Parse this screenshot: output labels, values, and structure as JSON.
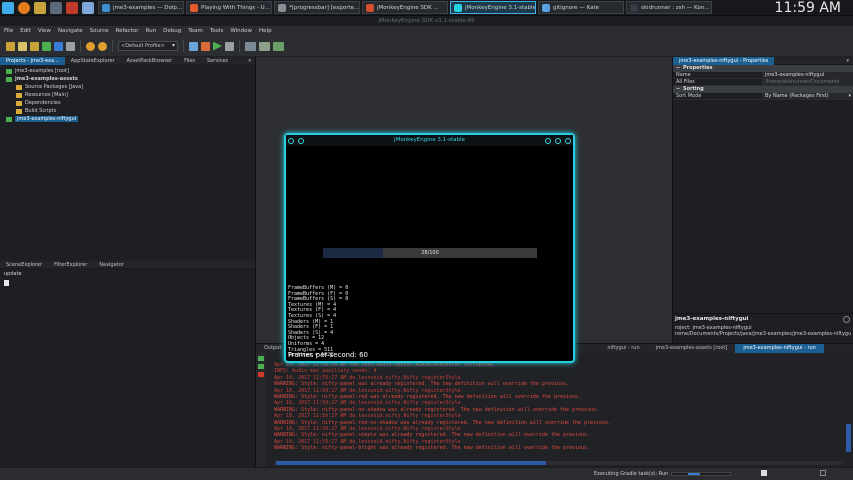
{
  "taskbar": {
    "tasks": [
      {
        "label": "jme3-examples — Dolp...",
        "color": "#3d8fd1",
        "active": false
      },
      {
        "label": "Playing With Things - U...",
        "color": "#e55b2b",
        "active": false
      },
      {
        "label": "*[progressbar] [exporte...",
        "color": "#8a8f96",
        "active": false
      },
      {
        "label": "jMonkeyEngine SDK ...",
        "color": "#d44f2b",
        "active": false
      },
      {
        "label": "jMonkeyEngine 3.1-stable",
        "color": "#27d0e0",
        "active": true
      },
      {
        "label": "gitignore — Kate",
        "color": "#5aa0e0",
        "active": false
      },
      {
        "label": "skidrunner : zsh — Kon...",
        "color": "#333b44",
        "active": false
      }
    ],
    "clock": "11:59 AM"
  },
  "titlebar": {
    "title": "jMonkeyEngine SDK v3.1-stable-86"
  },
  "menu": [
    "File",
    "Edit",
    "View",
    "Navigate",
    "Source",
    "Refactor",
    "Run",
    "Debug",
    "Team",
    "Tools",
    "Window",
    "Help"
  ],
  "toolbar": {
    "profile": "<Default Profile>"
  },
  "projects": {
    "tabs": [
      "Projects - jme3-exa...",
      "AppStateExplorer",
      "AssetPackBrowser",
      "Files",
      "Services"
    ],
    "tree": [
      {
        "label": "jme3-examples [root]",
        "bold": false
      },
      {
        "label": "jme3-examples-assets",
        "bold": true
      },
      {
        "label": "Source Packages [Java]",
        "bold": false
      },
      {
        "label": "Resources [Main]",
        "bold": false
      },
      {
        "label": "Dependencies",
        "bold": false
      },
      {
        "label": "Build Scripts",
        "bold": false
      },
      {
        "label": "jme3-examples-niftygui",
        "bold": false
      }
    ]
  },
  "bottomleft": {
    "tabs": [
      "SceneExplorer",
      "FilterExplorer",
      "Navigator"
    ],
    "item": "update"
  },
  "properties": {
    "tab": "jme3-examples-niftygui - Properties",
    "section1": "Properties",
    "rows": [
      {
        "k": "Name",
        "v": "jme3-examples-niftygui"
      },
      {
        "k": "All Files",
        "v": "/home/skidrunner/Documents"
      }
    ],
    "section2": "Sorting",
    "sort": {
      "k": "Sort Mode",
      "v": "By Name (Packages First)"
    },
    "info_title": "jme3-examples-niftygui",
    "info_line1": "roject: jme3-examples-niftygui",
    "info_line2": "rome/Documents/Projects/java/jme3-examples/jme3-examples-niftygui"
  },
  "output": {
    "panel_label": "Output",
    "tabs": [
      "niftygui - run",
      "jme3-examples-assets [root]",
      "jme3-examples-niftygui - run"
    ],
    "lines": [
      "Apr 10, 2017 11:59:26 AM com.jme3.audio.openal.ALAudioRenderer initOpenAL",
      "INFO: Audio max auxiliary sends: 4",
      "Apr 10, 2017 11:59:27 AM de.lessvoid.nifty.Nifty registerStyle",
      "WARNING: Style: nifty-panel was already registered. The new definition will override the previous.",
      "Apr 10, 2017 11:59:27 AM de.lessvoid.nifty.Nifty registerStyle",
      "WARNING: Style: nifty-panel-red was already registered. The new definition will override the previous.",
      "Apr 10, 2017 11:59:27 AM de.lessvoid.nifty.Nifty registerStyle",
      "WARNING: Style: nifty-panel-no-shadow was already registered. The new definition will override the previous.",
      "Apr 10, 2017 11:59:27 AM de.lessvoid.nifty.Nifty registerStyle",
      "WARNING: Style: nifty-panel-red-no-shadow was already registered. The new definition will override the previous.",
      "Apr 10, 2017 11:59:27 AM de.lessvoid.nifty.Nifty registerStyle",
      "WARNING: Style: nifty-panel-simple was already registered. The new definition will override the previous.",
      "Apr 10, 2017 11:59:27 AM de.lessvoid.nifty.Nifty registerStyle",
      "WARNING: Style: nifty-panel-bright was already registered. The new definition will override the previous."
    ]
  },
  "status": {
    "task": "Executing Gradle task(s): Run",
    "progress": 0.3
  },
  "game": {
    "title": "jMonkeyEngine 3.1-stable",
    "progress_label": "28/100",
    "progress": 0.28,
    "stats": [
      "FrameBuffers (M) = 0",
      "FrameBuffers (F) = 0",
      "FrameBuffers (S) = 0",
      "Textures (M) = 4",
      "Textures (F) = 4",
      "Textures (S) = 4",
      "Shaders (M) = 1",
      "Shaders (F) = 1",
      "Shaders (S) = 4",
      "Objects = 12",
      "Uniforms = 4",
      "Triangles = 511",
      "Vertices = 1022"
    ],
    "fps": "Frames per second: 60"
  }
}
